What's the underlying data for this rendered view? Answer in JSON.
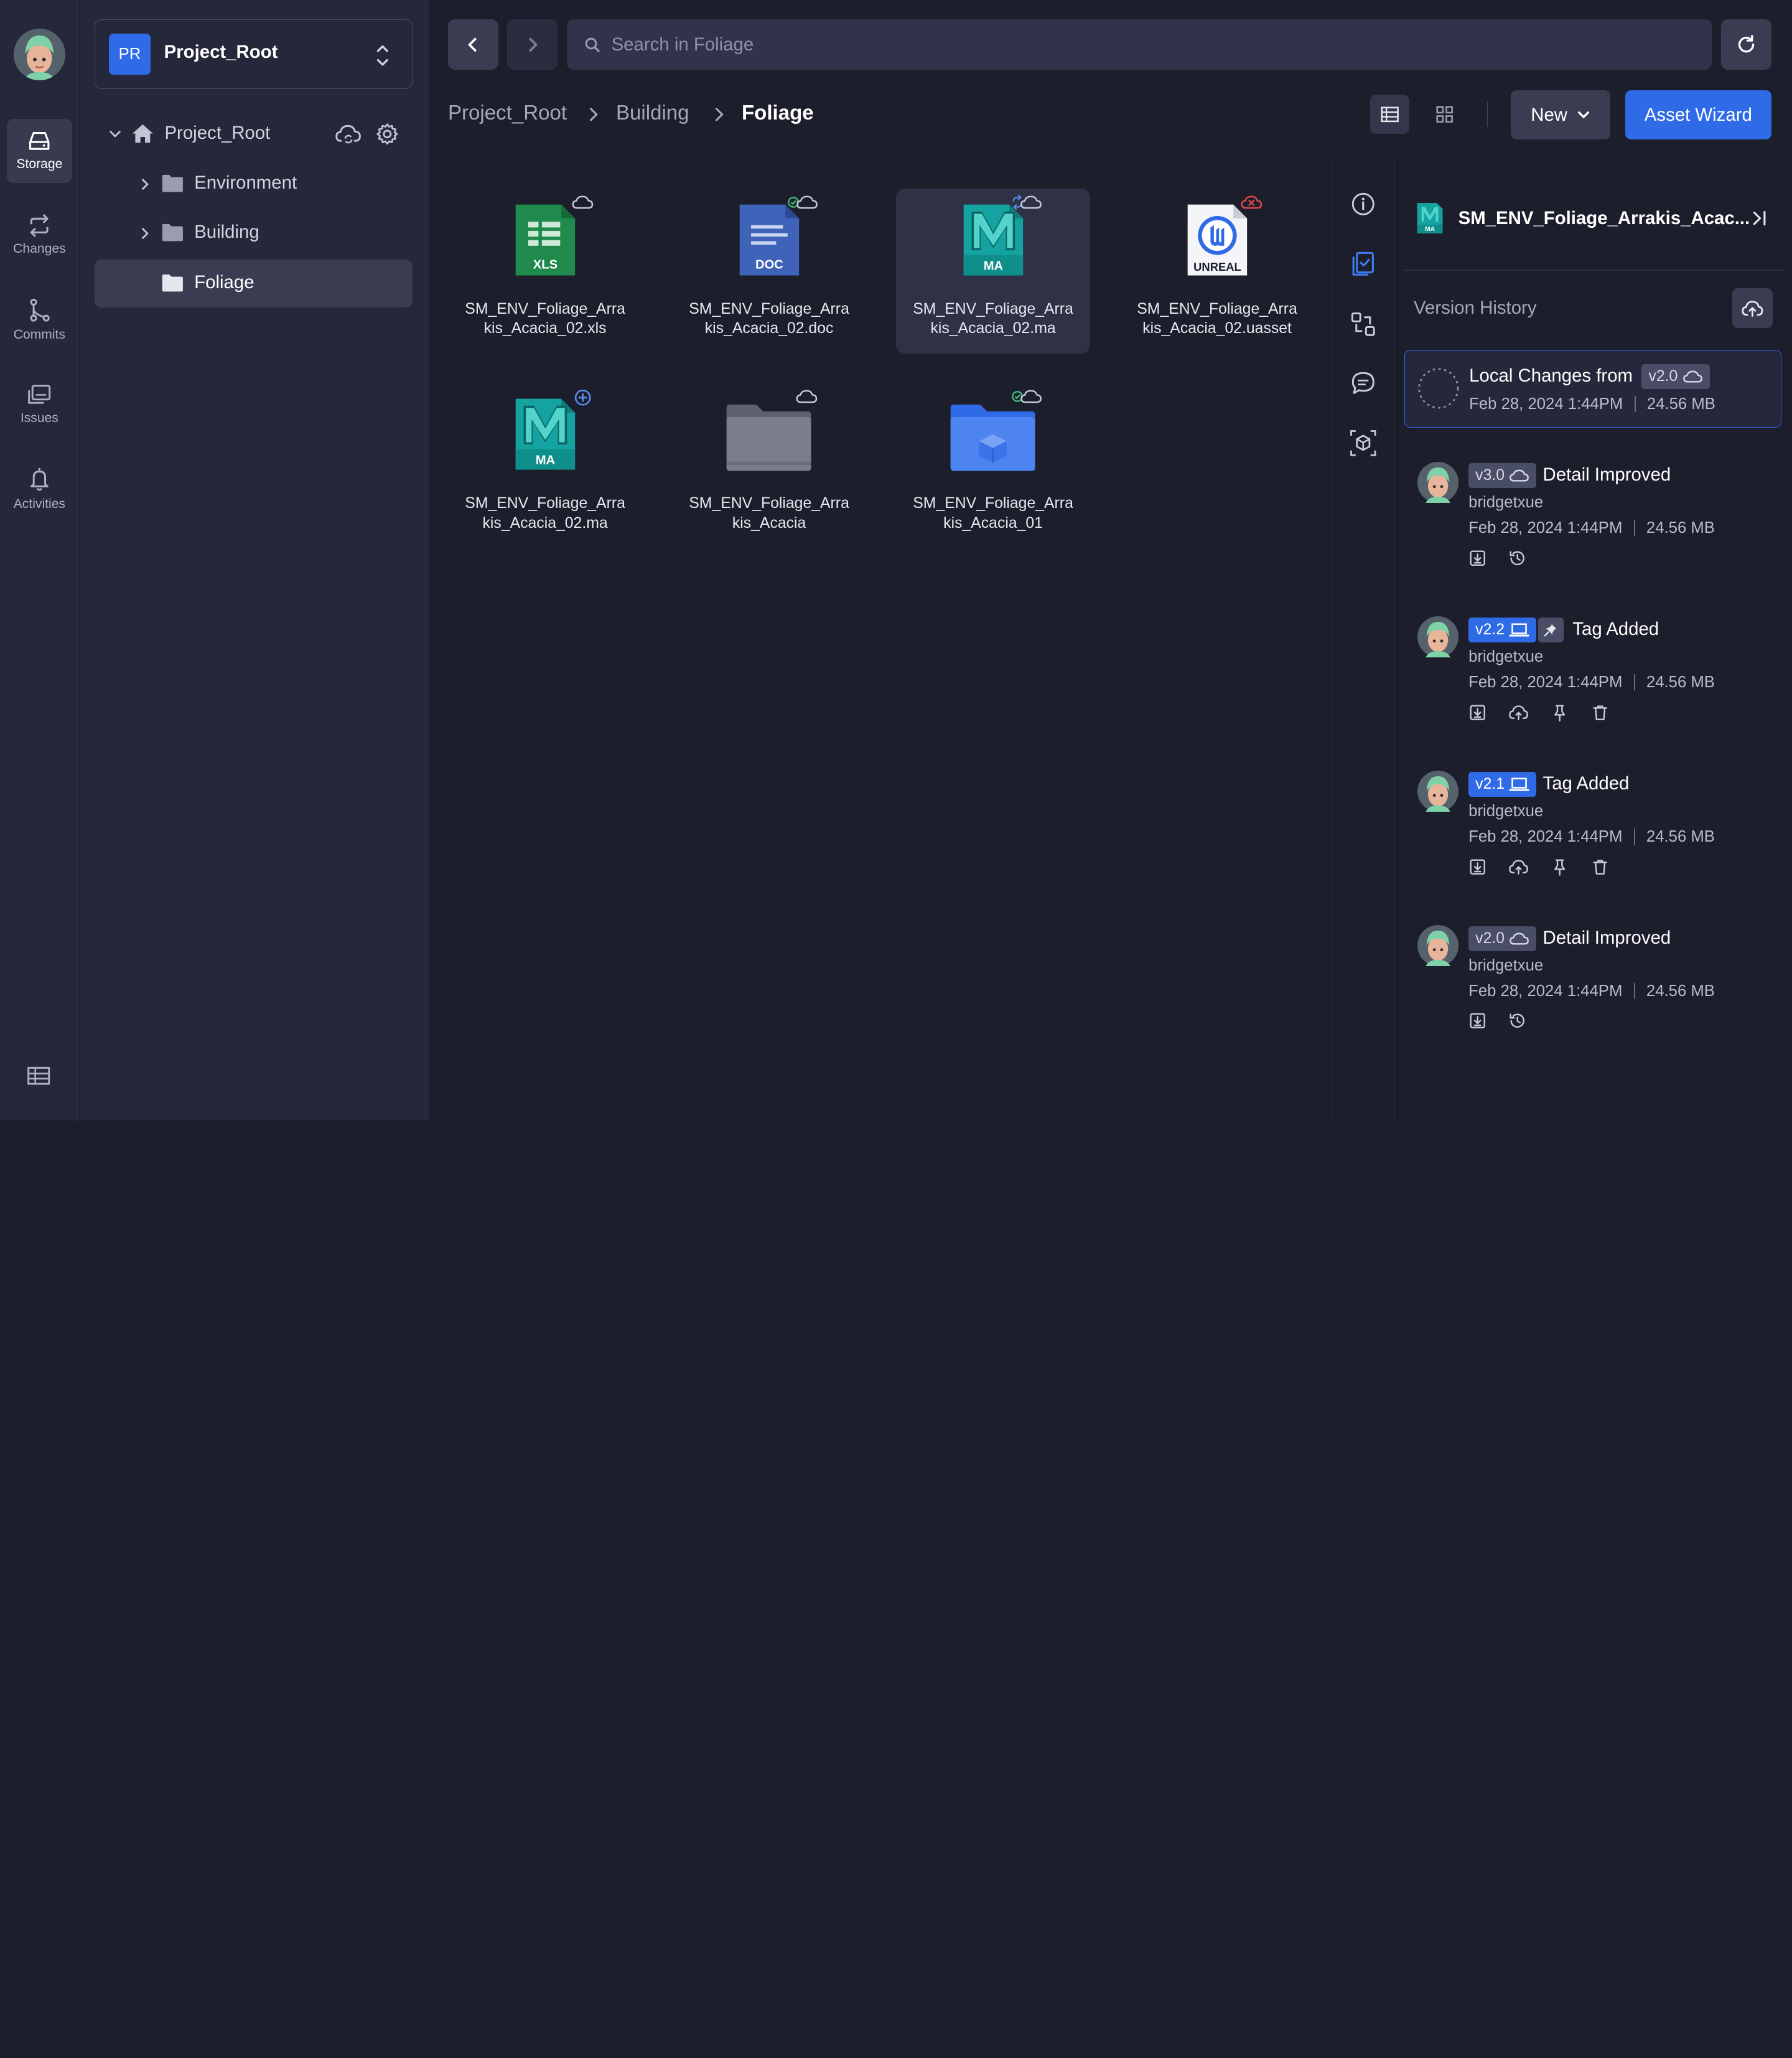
{
  "rail": {
    "items": [
      {
        "label": "Storage",
        "icon": "storage-icon"
      },
      {
        "label": "Changes",
        "icon": "changes-icon"
      },
      {
        "label": "Commits",
        "icon": "commits-icon"
      },
      {
        "label": "Issues",
        "icon": "issues-icon"
      },
      {
        "label": "Activities",
        "icon": "bell-icon"
      }
    ]
  },
  "project": {
    "badge": "PR",
    "name": "Project_Root"
  },
  "tree": {
    "root": "Project_Root",
    "children": [
      "Environment",
      "Building",
      "Foliage"
    ]
  },
  "search": {
    "placeholder": "Search in Foliage"
  },
  "breadcrumb": [
    "Project_Root",
    "Building",
    "Foliage"
  ],
  "toolbar": {
    "new_label": "New",
    "wizard_label": "Asset Wizard"
  },
  "files": [
    {
      "name": "SM_ENV_Foliage_Arrakis_Acacia_02.xls",
      "type": "XLS",
      "status": "cloud"
    },
    {
      "name": "SM_ENV_Foliage_Arrakis_Acacia_02.doc",
      "type": "DOC",
      "status": "synced-cloud"
    },
    {
      "name": "SM_ENV_Foliage_Arrakis_Acacia_02.ma",
      "type": "MA",
      "status": "sync-cloud",
      "selected": true
    },
    {
      "name": "SM_ENV_Foliage_Arrakis_Acacia_02.uasset",
      "type": "UNREAL",
      "status": "cloud-error"
    },
    {
      "name": "SM_ENV_Foliage_Arrakis_Acacia_02.ma",
      "type": "MA",
      "status": "added"
    },
    {
      "name": "SM_ENV_Foliage_Arrakis_Acacia",
      "type": "folder-gray",
      "status": "cloud"
    },
    {
      "name": "SM_ENV_Foliage_Arrakis_Acacia_01",
      "type": "folder-blue",
      "status": "synced-cloud"
    }
  ],
  "panel": {
    "title": "SM_ENV_Foliage_Arrakis_Acac...",
    "file_type": "MA",
    "section_title": "Version History",
    "versions": [
      {
        "title": "Local Changes from",
        "tag": "v2.0",
        "tag_icon": "cloud-icon",
        "user": "",
        "date": "Feb 28, 2024 1:44PM",
        "size": "24.56 MB",
        "local": true
      },
      {
        "title": "Detail Improved",
        "tag": "v3.0",
        "tag_icon": "cloud-icon",
        "user": "bridgetxue",
        "date": "Feb 28, 2024 1:44PM",
        "size": "24.56 MB",
        "actions": [
          "download-icon",
          "history-icon"
        ]
      },
      {
        "title": "Tag Added",
        "tag": "v2.2",
        "tag_icon": "laptop-icon",
        "pinned": true,
        "user": "bridgetxue",
        "date": "Feb 28, 2024 1:44PM",
        "size": "24.56 MB",
        "actions": [
          "download-icon",
          "upload-icon",
          "pin-icon",
          "trash-icon"
        ]
      },
      {
        "title": "Tag Added",
        "tag": "v2.1",
        "tag_icon": "laptop-icon",
        "user": "bridgetxue",
        "date": "Feb 28, 2024 1:44PM",
        "size": "24.56 MB",
        "actions": [
          "download-icon",
          "upload-icon",
          "pin-icon",
          "trash-icon"
        ]
      },
      {
        "title": "Detail Improved",
        "tag": "v2.0",
        "tag_icon": "cloud-icon",
        "user": "bridgetxue",
        "date": "Feb 28, 2024 1:44PM",
        "size": "24.56 MB",
        "actions": [
          "download-icon",
          "history-icon"
        ]
      }
    ]
  },
  "colors": {
    "accent": "#2f6be6",
    "bg": "#1d1e2c",
    "panel": "#25273a",
    "error": "#e5484d",
    "success": "#3fb97a"
  }
}
